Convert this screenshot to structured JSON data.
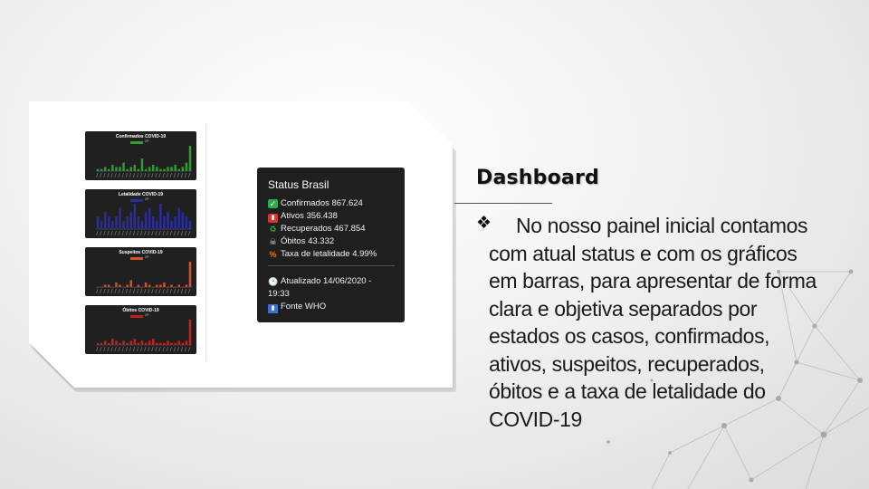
{
  "mini_charts": [
    {
      "title": "Confirmados COVID-19",
      "legend": "UF",
      "color": "#2f9e2f",
      "values": [
        1,
        1,
        2,
        1,
        3,
        2,
        2,
        4,
        1,
        2,
        3,
        1,
        6,
        1,
        2,
        3,
        2,
        1,
        1,
        2,
        2,
        3,
        1,
        2,
        4,
        12
      ]
    },
    {
      "title": "Letalidade COVID-19",
      "legend": "UF",
      "color": "#2c2c9e",
      "values": [
        3,
        2,
        4,
        3,
        2,
        3,
        5,
        2,
        3,
        4,
        6,
        3,
        2,
        4,
        5,
        3,
        2,
        6,
        3,
        4,
        2,
        3,
        5,
        4,
        3,
        2
      ]
    },
    {
      "title": "Suspeitos COVID-19",
      "legend": "UF",
      "color": "#d4522a",
      "values": [
        0,
        0,
        1,
        1,
        0,
        2,
        1,
        0,
        1,
        3,
        0,
        1,
        0,
        2,
        1,
        0,
        1,
        1,
        2,
        0,
        1,
        0,
        1,
        0,
        1,
        11
      ]
    },
    {
      "title": "Óbitos COVID-19",
      "legend": "UF",
      "color": "#c42020",
      "values": [
        1,
        1,
        2,
        1,
        3,
        2,
        1,
        2,
        1,
        2,
        3,
        1,
        2,
        1,
        2,
        3,
        1,
        1,
        1,
        2,
        1,
        1,
        2,
        1,
        2,
        12
      ]
    }
  ],
  "status_panel": {
    "title": "Status Brasil",
    "confirmados": "Confirmados 867.624",
    "ativos": "Ativos 356.438",
    "recuperados": "Recuperados 467.854",
    "obitos": "Óbitos 43.332",
    "letalidade": "Taxa de letalidade 4.99%",
    "atualizado_1": "Atualizado 14/06/2020 -",
    "atualizado_2": "19:33",
    "fonte": "Fonte WHO"
  },
  "heading": "Dashboard",
  "paragraph_lines": [
    "No nosso painel inicial contamos",
    "com atual status e com os gráficos",
    "em barras, para apresentar de forma",
    "clara e objetiva separados por",
    "estados os casos, confirmados,",
    "ativos, suspeitos, recuperados,",
    "óbitos e a taxa de letalidade do",
    "COVID-19"
  ]
}
